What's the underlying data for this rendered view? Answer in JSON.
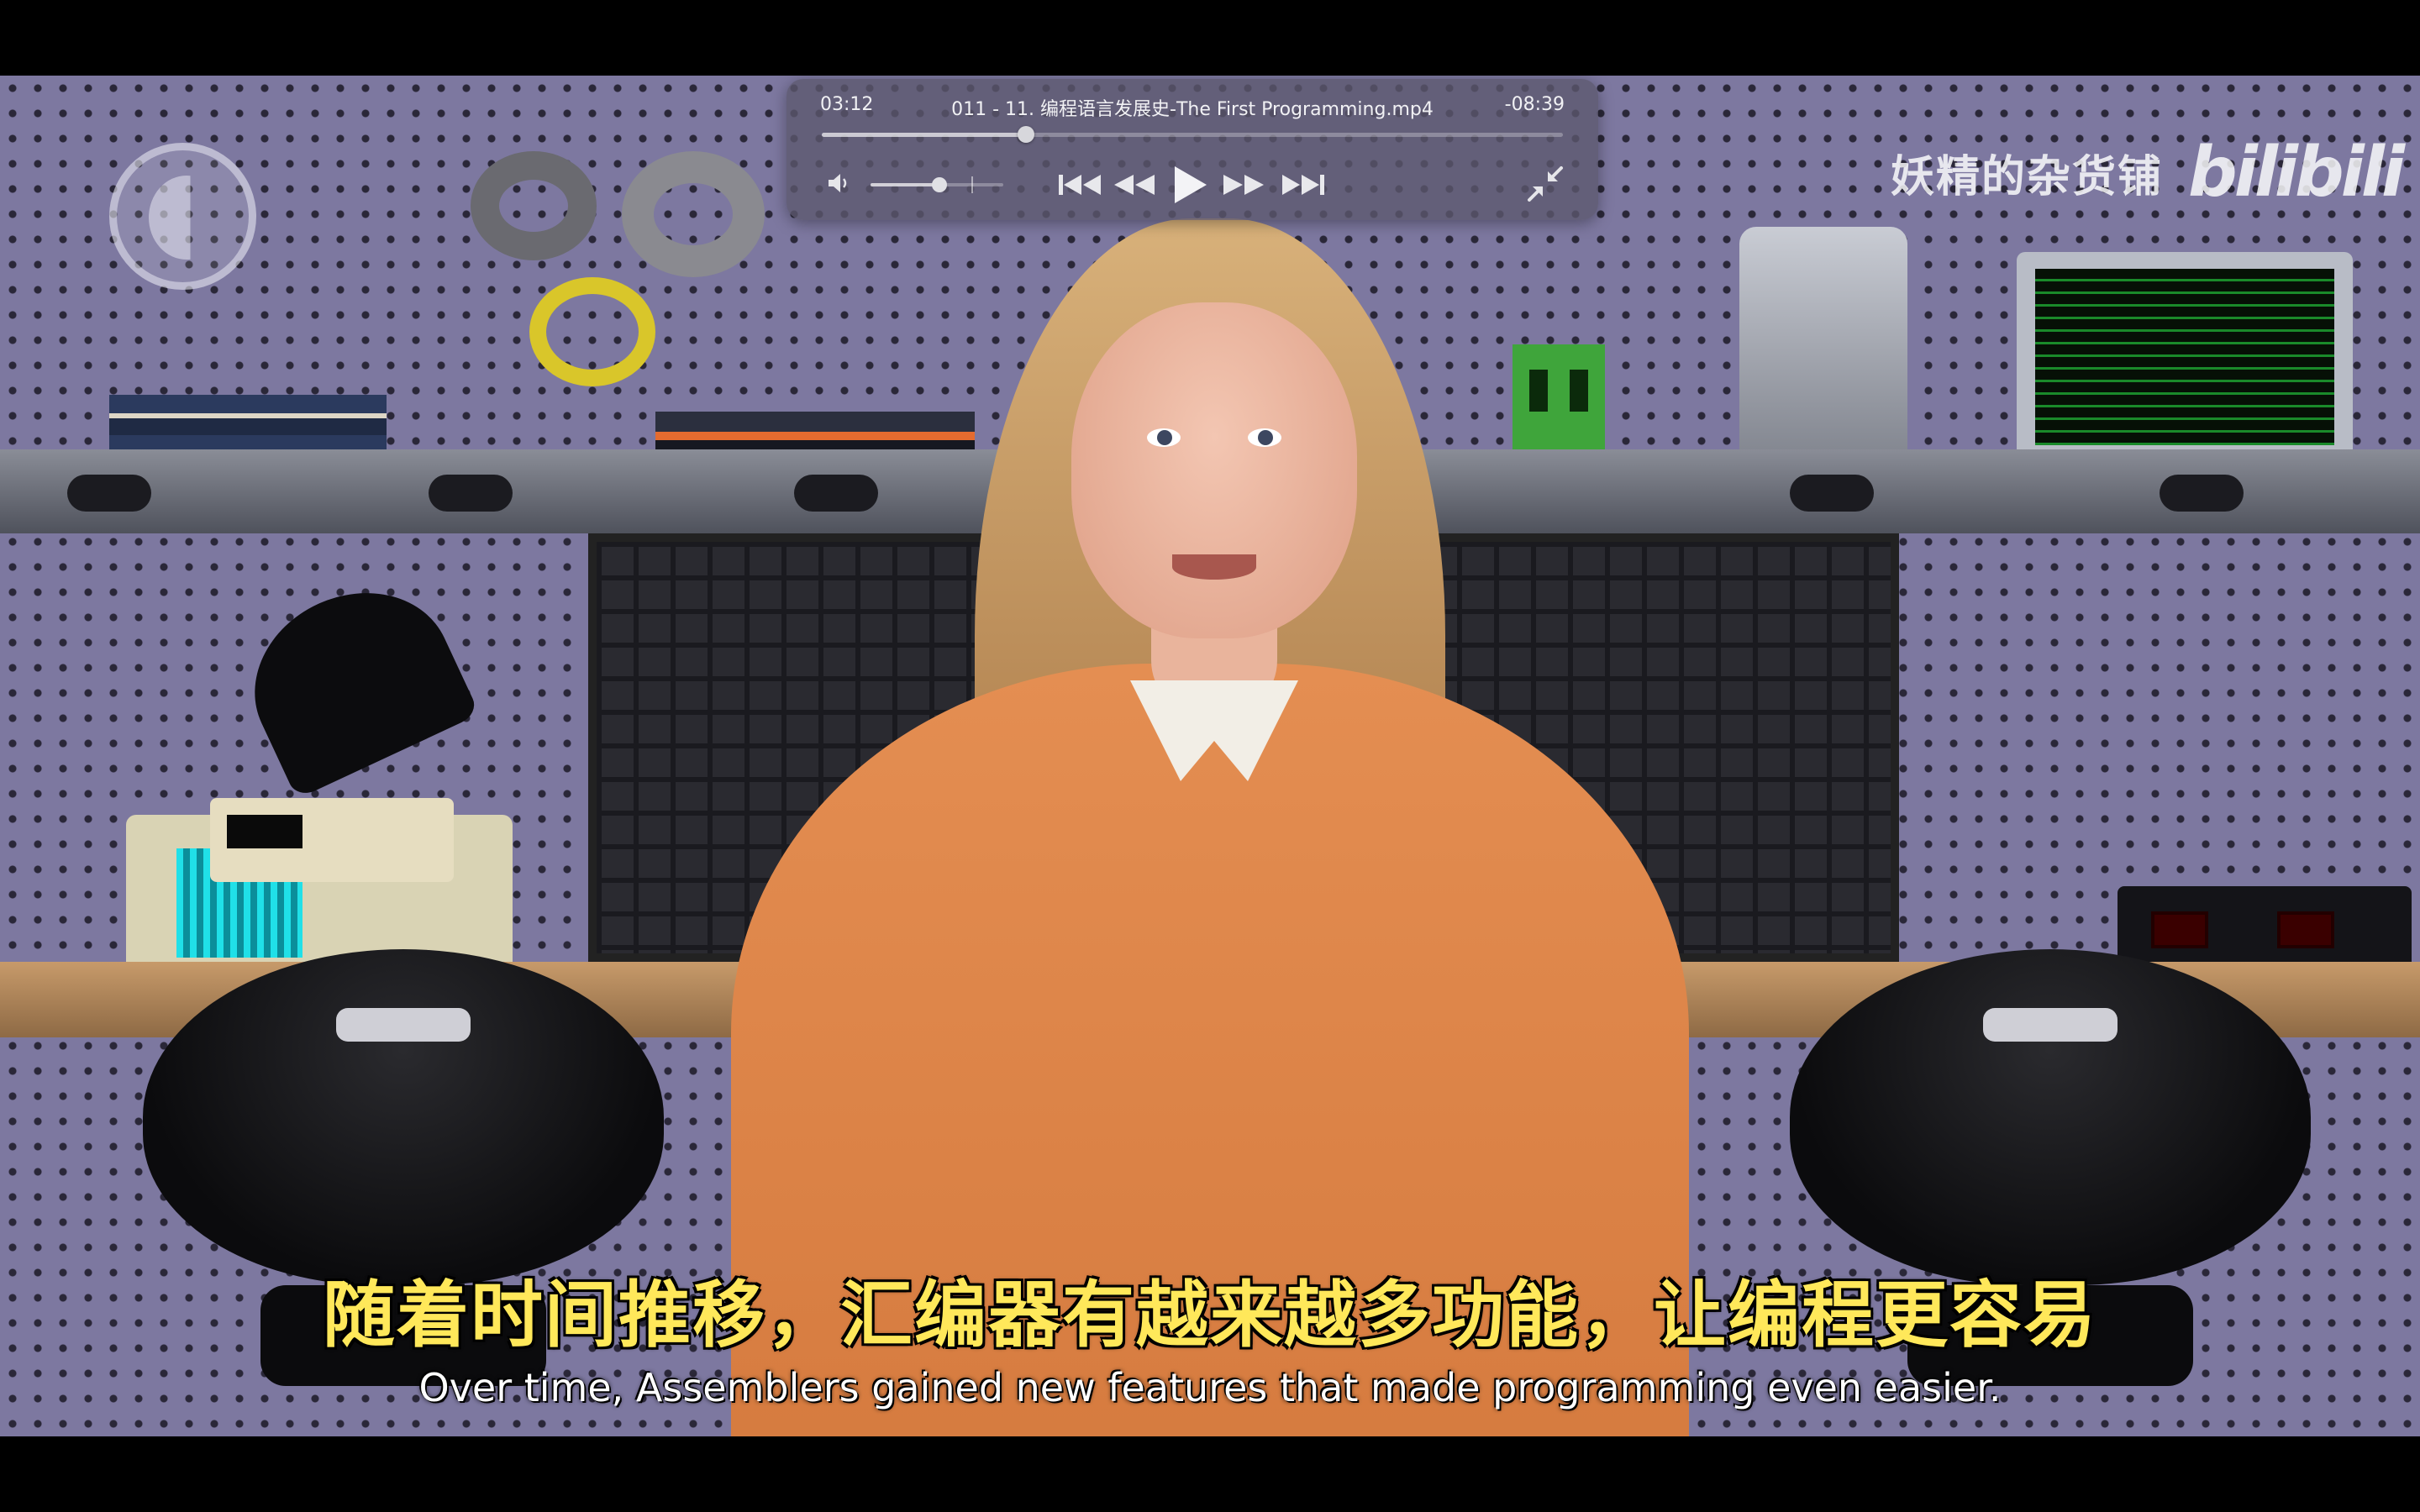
{
  "player": {
    "time_elapsed": "03:12",
    "file_title": "011 - 11. 编程语言发展史-The First Programming.mp4",
    "time_remaining": "-08:39",
    "progress_fraction": 0.276,
    "volume_fraction": 0.52,
    "controls": {
      "skip_back": "previous-track-icon",
      "rewind": "rewind-icon",
      "play": "play-icon",
      "fast_forward": "fast-forward-icon",
      "skip_forward": "next-track-icon",
      "volume": "speaker-icon",
      "exit_fullscreen": "exit-fullscreen-icon"
    },
    "colors": {
      "hud_background": "#5c586e",
      "hud_text": "#f1f1f4"
    }
  },
  "video": {
    "watermark_channel": "妖精的杂货铺",
    "watermark_brand": "bilibili",
    "corner_logo": "pbs-logo-icon",
    "subtitle_zh": "随着时间推移，汇编器有越来越多功能，让编程更容易",
    "subtitle_en": "Over time, Assemblers gained new features that made programming even easier.",
    "colors": {
      "subtitle_zh": "#ffe85a",
      "subtitle_en": "#ffffff"
    }
  }
}
